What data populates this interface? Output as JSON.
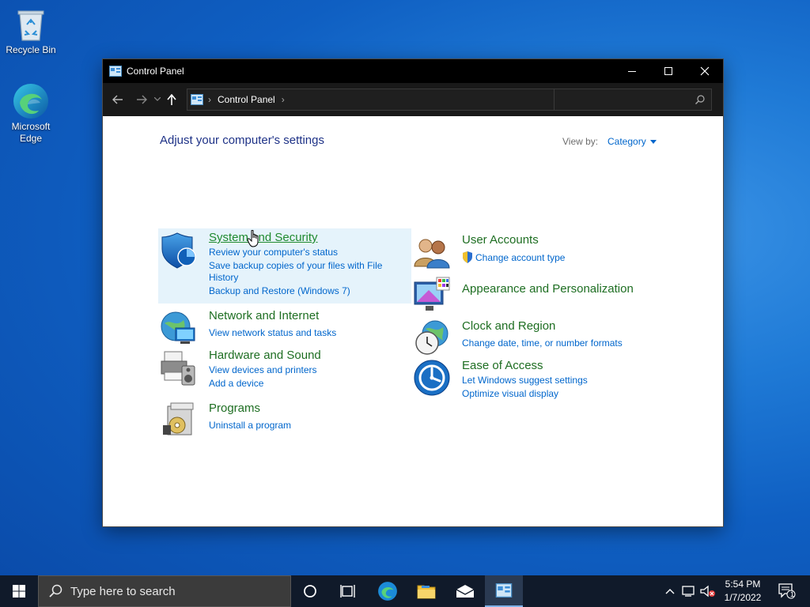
{
  "desktop": {
    "icons": [
      {
        "label": "Recycle Bin",
        "icon": "recycle-bin-icon"
      },
      {
        "label": "Microsoft Edge",
        "icon": "edge-icon"
      }
    ]
  },
  "window": {
    "title": "Control Panel",
    "address": {
      "breadcrumb": "Control Panel",
      "separator": "›"
    },
    "search": {
      "value": "",
      "placeholder": ""
    }
  },
  "content": {
    "heading": "Adjust your computer's settings",
    "view_by_label": "View by:",
    "view_by_value": "Category",
    "categories": [
      {
        "title": "System and Security",
        "icon": "shield-icon",
        "links": [
          "Review your computer's status",
          "Save backup copies of your files with File History",
          "Backup and Restore (Windows 7)"
        ]
      },
      {
        "title": "Network and Internet",
        "icon": "network-globe-icon",
        "links": [
          "View network status and tasks"
        ]
      },
      {
        "title": "Hardware and Sound",
        "icon": "printer-speaker-icon",
        "links": [
          "View devices and printers",
          "Add a device"
        ]
      },
      {
        "title": "Programs",
        "icon": "programs-disc-icon",
        "links": [
          "Uninstall a program"
        ]
      },
      {
        "title": "User Accounts",
        "icon": "users-icon",
        "links": [
          "Change account type"
        ]
      },
      {
        "title": "Appearance and Personalization",
        "icon": "monitor-palette-icon",
        "links": []
      },
      {
        "title": "Clock and Region",
        "icon": "clock-globe-icon",
        "links": [
          "Change date, time, or number formats"
        ]
      },
      {
        "title": "Ease of Access",
        "icon": "ease-of-access-icon",
        "links": [
          "Let Windows suggest settings",
          "Optimize visual display"
        ]
      }
    ]
  },
  "taskbar": {
    "search_placeholder": "Type here to search",
    "time": "5:54 PM",
    "date": "1/7/2022",
    "notification_count": "1"
  },
  "colors": {
    "category_title": "#1e6e22",
    "link": "#0066cc",
    "heading": "#1e3287",
    "highlight": "#e5f3fb"
  }
}
